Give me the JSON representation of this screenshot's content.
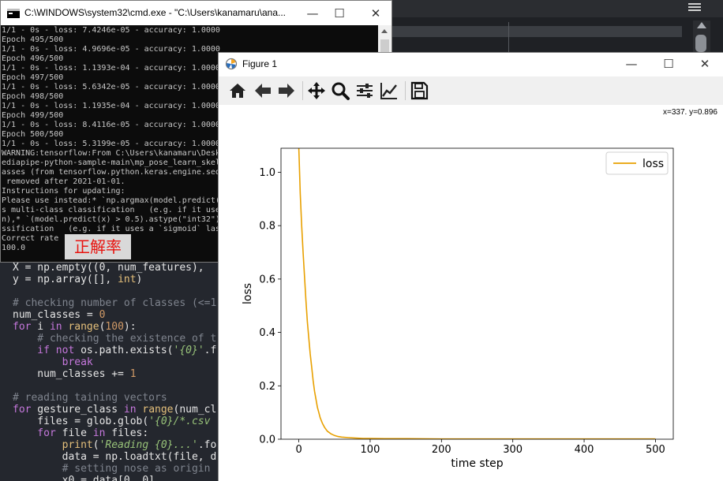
{
  "editor": {
    "code_lines": [
      [
        [
          "t-pl",
          "X = np.empty((0, num_features), "
        ]
      ],
      [
        [
          "t-pl",
          "y = np.array([], "
        ],
        [
          "t-bi",
          "int"
        ],
        [
          "t-pl",
          ")"
        ]
      ],
      [
        [
          "t-pl",
          ""
        ]
      ],
      [
        [
          "t-com",
          "# checking number of classes (<=1"
        ]
      ],
      [
        [
          "t-pl",
          "num_classes = "
        ],
        [
          "t-num",
          "0"
        ]
      ],
      [
        [
          "t-kw",
          "for"
        ],
        [
          "t-pl",
          " i "
        ],
        [
          "t-kw",
          "in"
        ],
        [
          "t-pl",
          " "
        ],
        [
          "t-fn",
          "range"
        ],
        [
          "t-pl",
          "("
        ],
        [
          "t-num",
          "100"
        ],
        [
          "t-pl",
          "):"
        ]
      ],
      [
        [
          "t-com",
          "    # checking the existence of t"
        ]
      ],
      [
        [
          "t-kw",
          "    if not"
        ],
        [
          "t-pl",
          " os.path.exists("
        ],
        [
          "t-it",
          "'{0}'"
        ],
        [
          "t-pl",
          ".f"
        ]
      ],
      [
        [
          "t-kw",
          "        break"
        ]
      ],
      [
        [
          "t-pl",
          "    num_classes += "
        ],
        [
          "t-num",
          "1"
        ]
      ],
      [
        [
          "t-pl",
          ""
        ]
      ],
      [
        [
          "t-com",
          "# reading taining vectors"
        ]
      ],
      [
        [
          "t-kw",
          "for"
        ],
        [
          "t-pl",
          " gesture_class "
        ],
        [
          "t-kw",
          "in"
        ],
        [
          "t-pl",
          " "
        ],
        [
          "t-fn",
          "range"
        ],
        [
          "t-pl",
          "(num_cl"
        ]
      ],
      [
        [
          "t-pl",
          "    files = glob.glob("
        ],
        [
          "t-it",
          "'{0}/*.csv"
        ]
      ],
      [
        [
          "t-kw",
          "    for"
        ],
        [
          "t-pl",
          " file "
        ],
        [
          "t-kw",
          "in"
        ],
        [
          "t-pl",
          " files:"
        ]
      ],
      [
        [
          "t-fn",
          "        print"
        ],
        [
          "t-pl",
          "("
        ],
        [
          "t-it",
          "'Reading {0}...'"
        ],
        [
          "t-pl",
          ".fo"
        ]
      ],
      [
        [
          "t-pl",
          "        data = np.loadtxt(file, d"
        ]
      ],
      [
        [
          "t-com",
          "        # setting nose as origin"
        ]
      ],
      [
        [
          "t-pl",
          "        x0 = data[0, 0]"
        ]
      ]
    ]
  },
  "cmd": {
    "title": "C:\\WINDOWS\\system32\\cmd.exe - \"C:\\Users\\kanamaru\\ana...",
    "controls": {
      "minimize": "—",
      "maximize": "☐",
      "close": "✕"
    },
    "lines": [
      "1/1 - 0s - loss: 7.4246e-05 - accuracy: 1.0000",
      "Epoch 495/500",
      "1/1 - 0s - loss: 4.9696e-05 - accuracy: 1.0000",
      "Epoch 496/500",
      "1/1 - 0s - loss: 1.1393e-04 - accuracy: 1.0000",
      "Epoch 497/500",
      "1/1 - 0s - loss: 5.6342e-05 - accuracy: 1.0000",
      "Epoch 498/500",
      "1/1 - 0s - loss: 1.1935e-04 - accuracy: 1.0000",
      "Epoch 499/500",
      "1/1 - 0s - loss: 8.4116e-05 - accuracy: 1.0000",
      "Epoch 500/500",
      "1/1 - 0s - loss: 5.3199e-05 - accuracy: 1.0000",
      "WARNING:tensorflow:From C:\\Users\\kanamaru\\Desk",
      "ediapipe-python-sample-main\\mp_pose_learn_skel",
      "asses (from tensorflow.python.keras.engine.seq",
      " removed after 2021-01-01.",
      "Instructions for updating:",
      "Please use instead:* `np.argmax(model.predict(",
      "s multi-class classification   (e.g. if it use",
      "n),* `(model.predict(x) > 0.5).astype(\"int32\")",
      "ssification   (e.g. if it uses a `sigmoid` las",
      "Correct rate",
      "100.0"
    ],
    "annotation": "正解率"
  },
  "figure": {
    "title": "Figure 1",
    "controls": {
      "minimize": "—",
      "maximize": "☐",
      "close": "✕"
    },
    "toolbar": [
      "home-icon",
      "back-arrow-icon",
      "forward-arrow-icon",
      "pan-move-icon",
      "zoom-magnifier-icon",
      "subplots-sliders-icon",
      "edit-axis-icon",
      "save-floppy-icon"
    ],
    "coords": "x=337. y=0.896"
  },
  "chart_data": {
    "type": "line",
    "title": "",
    "xlabel": "time step",
    "ylabel": "loss",
    "xlim": [
      -25,
      525
    ],
    "ylim": [
      0.0,
      1.09
    ],
    "xticks": [
      0,
      100,
      200,
      300,
      400,
      500
    ],
    "yticks": [
      0.0,
      0.2,
      0.4,
      0.6,
      0.8,
      1.0
    ],
    "ytick_labels": [
      "0.0",
      "0.2",
      "0.4",
      "0.6",
      "0.8",
      "1.0"
    ],
    "legend": "upper-right",
    "color": "#e8a000",
    "series": [
      {
        "name": "loss",
        "x": [
          0,
          2,
          4,
          6,
          8,
          10,
          12,
          14,
          16,
          18,
          20,
          22,
          24,
          26,
          28,
          30,
          33,
          36,
          40,
          45,
          50,
          55,
          60,
          70,
          80,
          90,
          100,
          120,
          150,
          200,
          250,
          300,
          350,
          400,
          450,
          500
        ],
        "y": [
          1.09,
          0.92,
          0.8,
          0.7,
          0.61,
          0.52,
          0.44,
          0.38,
          0.32,
          0.27,
          0.22,
          0.18,
          0.15,
          0.12,
          0.1,
          0.08,
          0.06,
          0.045,
          0.03,
          0.02,
          0.014,
          0.01,
          0.008,
          0.006,
          0.004,
          0.003,
          0.003,
          0.002,
          0.002,
          0.001,
          0.001,
          0.001,
          0.001,
          0.001,
          0.001,
          0.001
        ]
      }
    ]
  }
}
